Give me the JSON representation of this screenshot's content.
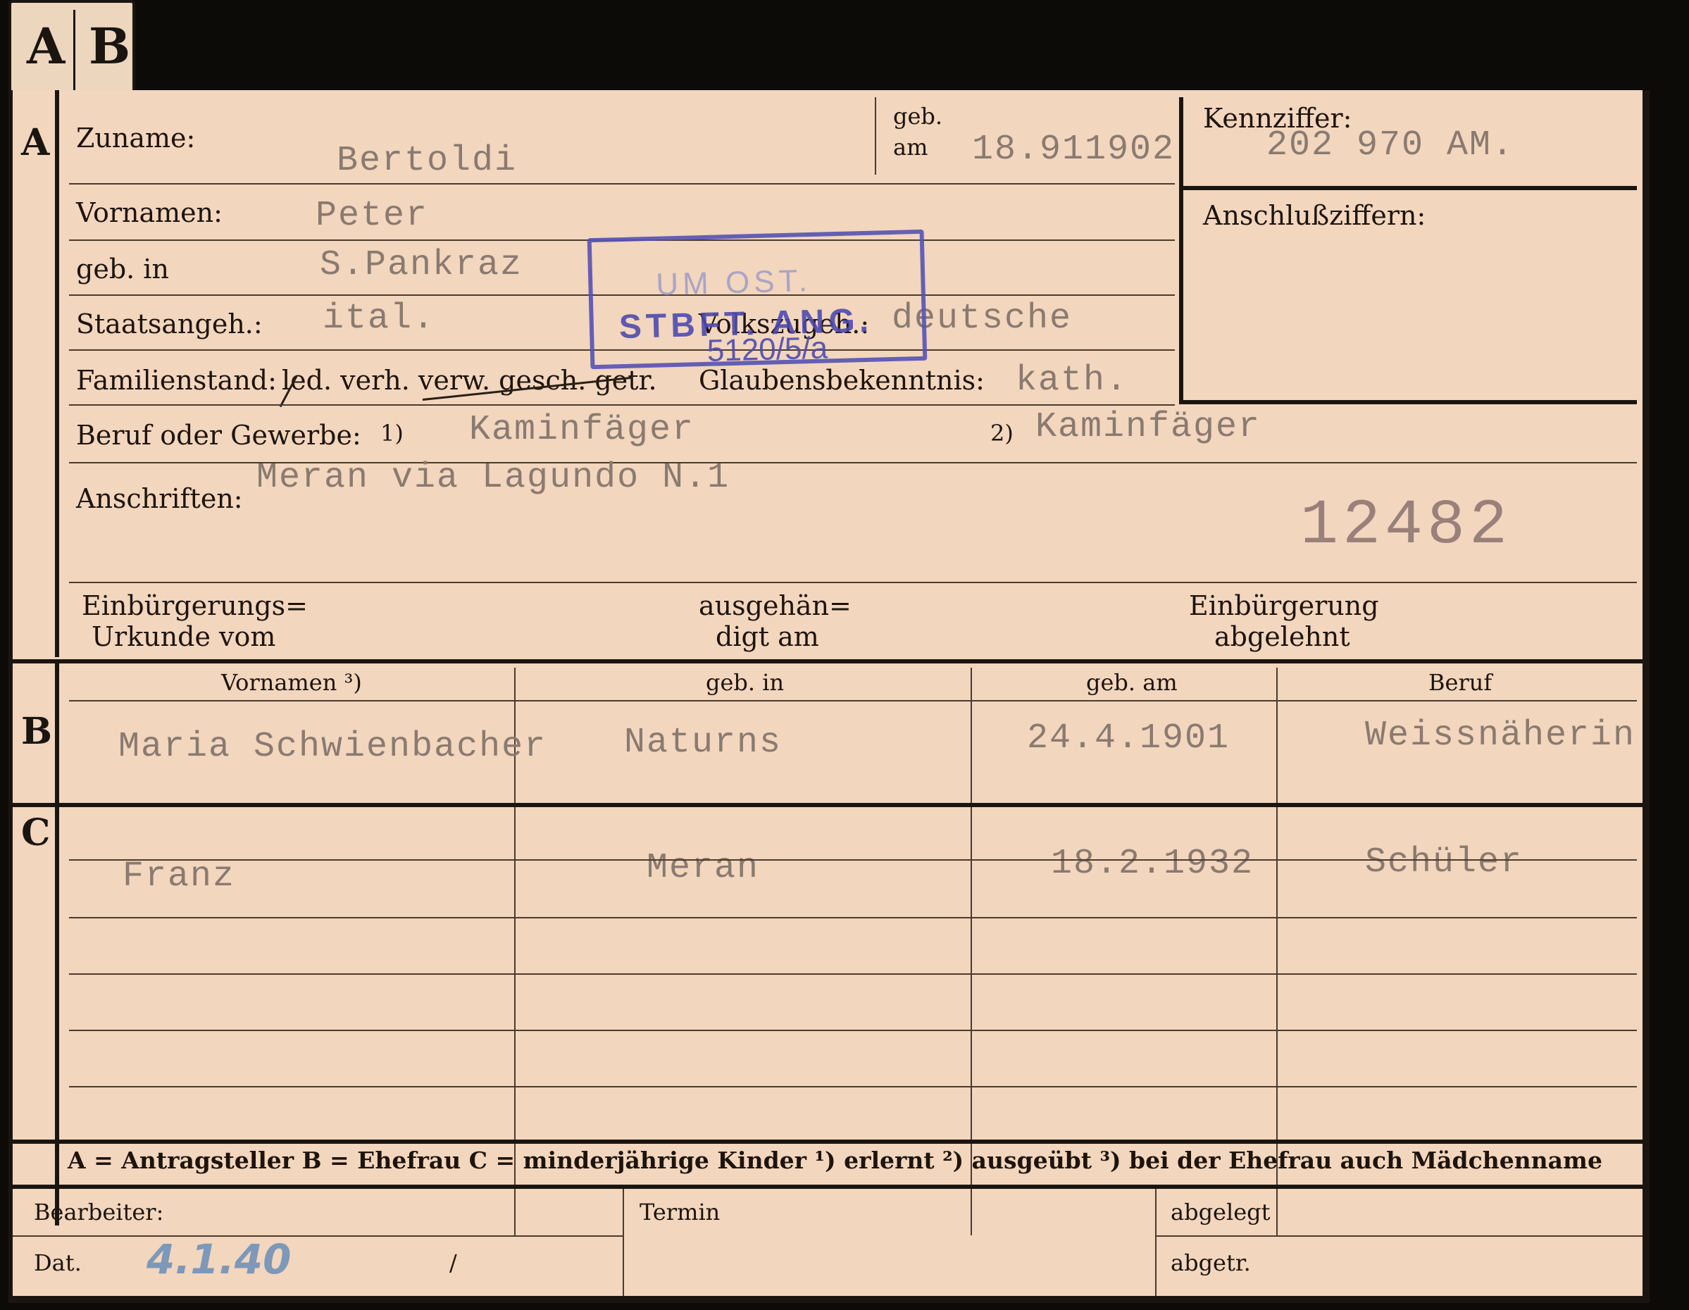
{
  "tabs": {
    "a": "A",
    "b": "B"
  },
  "section_a": {
    "letter": "A",
    "zuname_label": "Zuname:",
    "zuname_value": "Bertoldi",
    "geb_am_label_1": "geb.",
    "geb_am_label_2": "am",
    "geb_am_value": "18.911902",
    "kennziffer_label": "Kennziffer:",
    "kennziffer_value": "202 970 AM.",
    "anschluss_label": "Anschlußziffern:",
    "vornamen_label": "Vornamen:",
    "vornamen_value": "Peter",
    "geb_in_label": "geb. in",
    "geb_in_value": "S.Pankraz",
    "staatsangeh_label": "Staatsangeh.:",
    "staatsangeh_value": "ital.",
    "volkszugeh_label": "Volkszugeh.:",
    "volkszugeh_value": "deutsche",
    "familienstand_label": "Familienstand:",
    "familienstand_options": "led. verh. verw. gesch. getr.",
    "glaubens_label": "Glaubensbekenntnis:",
    "glaubens_value": "kath.",
    "beruf_label": "Beruf oder Gewerbe:",
    "beruf_mark_1": "1)",
    "beruf_value_1": "Kaminfäger",
    "beruf_mark_2": "2)",
    "beruf_value_2": "Kaminfäger",
    "anschriften_label": "Anschriften:",
    "anschriften_value": "Meran via Lagundo N.1",
    "file_number": "12482",
    "einb_label_1": "Einbürgerungs=",
    "einb_label_2": "Urkunde vom",
    "ausgeh_label_1": "ausgehän=",
    "ausgeh_label_2": "digt am",
    "abgelehnt_label_1": "Einbürgerung",
    "abgelehnt_label_2": "abgelehnt"
  },
  "stamp": {
    "line1": "UM OST.",
    "line2": "STBFT. ANG.",
    "line3": "5120/5/a"
  },
  "section_b": {
    "letter": "B",
    "headers": [
      "Vornamen ³)",
      "geb. in",
      "geb. am",
      "Beruf"
    ],
    "row": [
      "Maria Schwienbacher",
      "Naturns",
      "24.4.1901",
      "Weissnäherin"
    ]
  },
  "section_c": {
    "letter": "C",
    "row": [
      "Franz",
      "Meran",
      "18.2.1932",
      "Schüler"
    ]
  },
  "legend": "A = Antragsteller   B = Ehefrau   C = minderjährige Kinder   ¹) erlernt   ²) ausgeübt   ³) bei der Ehefrau auch Mädchenname",
  "footer": {
    "bearbeiter_label": "Bearbeiter:",
    "dat_label": "Dat.",
    "dat_value": "4.1.40",
    "slash": "/",
    "termin_label": "Termin",
    "abgelegt_label": "abgelegt",
    "abgetr_label": "abgetr."
  },
  "colors": {
    "card": "#f2d6be",
    "ink": "#1e140c",
    "stamp": "#4d4bb0",
    "typed": "#8a7a70"
  }
}
